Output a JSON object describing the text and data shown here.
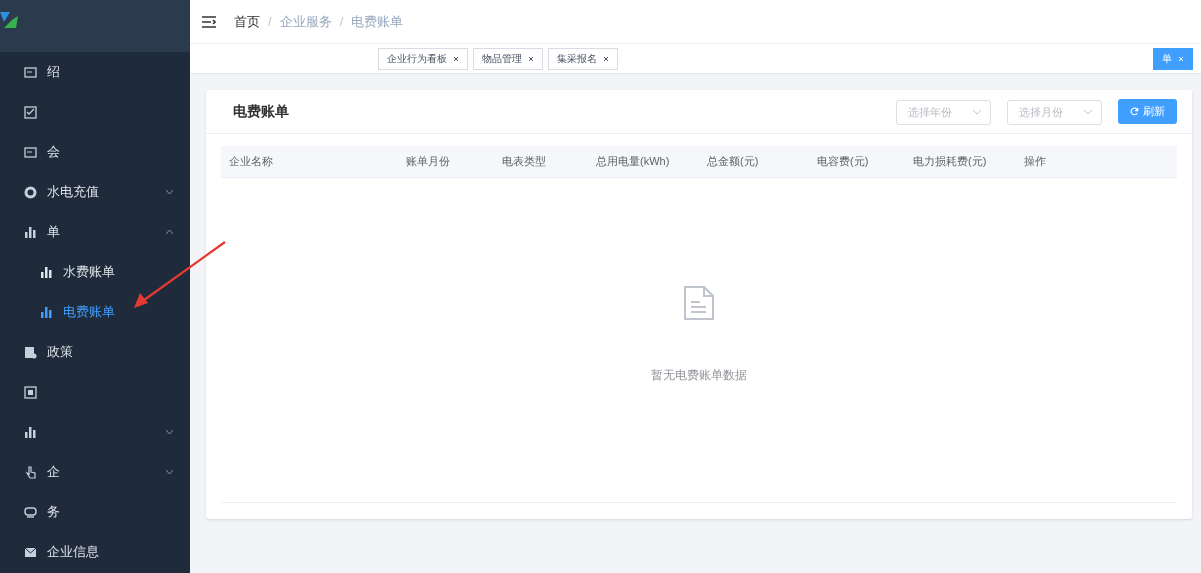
{
  "sidebar": {
    "items": [
      {
        "kind": "item",
        "label": "绍"
      },
      {
        "kind": "item"
      },
      {
        "kind": "item",
        "label": "会"
      },
      {
        "kind": "submenu",
        "label": "水电充值",
        "expanded": false
      },
      {
        "kind": "submenu",
        "label": "单",
        "expanded": true,
        "children": [
          {
            "label": "水费账单",
            "selected": false
          },
          {
            "label": "电费账单",
            "selected": true
          }
        ]
      },
      {
        "kind": "item",
        "label": "政策"
      },
      {
        "kind": "item"
      },
      {
        "kind": "submenu",
        "expanded": false
      },
      {
        "kind": "submenu",
        "label": "企",
        "expanded": false
      },
      {
        "kind": "item",
        "label": "务"
      },
      {
        "kind": "item",
        "label": "企业信息"
      }
    ]
  },
  "breadcrumb": [
    {
      "kind": "link",
      "text": "首页"
    },
    {
      "kind": "separator",
      "text": "/"
    },
    {
      "kind": "link",
      "text": "企业服务"
    },
    {
      "kind": "separator",
      "text": "/"
    },
    {
      "kind": "current",
      "text": "电费账单"
    }
  ],
  "tabs": [
    {
      "label": "企业行为看板",
      "selected": false
    },
    {
      "label": "物品管理",
      "selected": false
    },
    {
      "label": "集采报名",
      "selected": false
    },
    {
      "label": "单",
      "selected": true
    }
  ],
  "card": {
    "title": "电费账单",
    "filters": [
      {
        "placeholder": "选择年份"
      },
      {
        "placeholder": "选择月份"
      }
    ],
    "refresh_button": "刷新",
    "table": {
      "columns": [
        "企业名称",
        "账单月份",
        "电表类型",
        "总用电量(kWh)",
        "总金额(元)",
        "电容费(元)",
        "电力损耗费(元)",
        "操作"
      ],
      "empty_text": "暂无电费账单数据"
    }
  }
}
